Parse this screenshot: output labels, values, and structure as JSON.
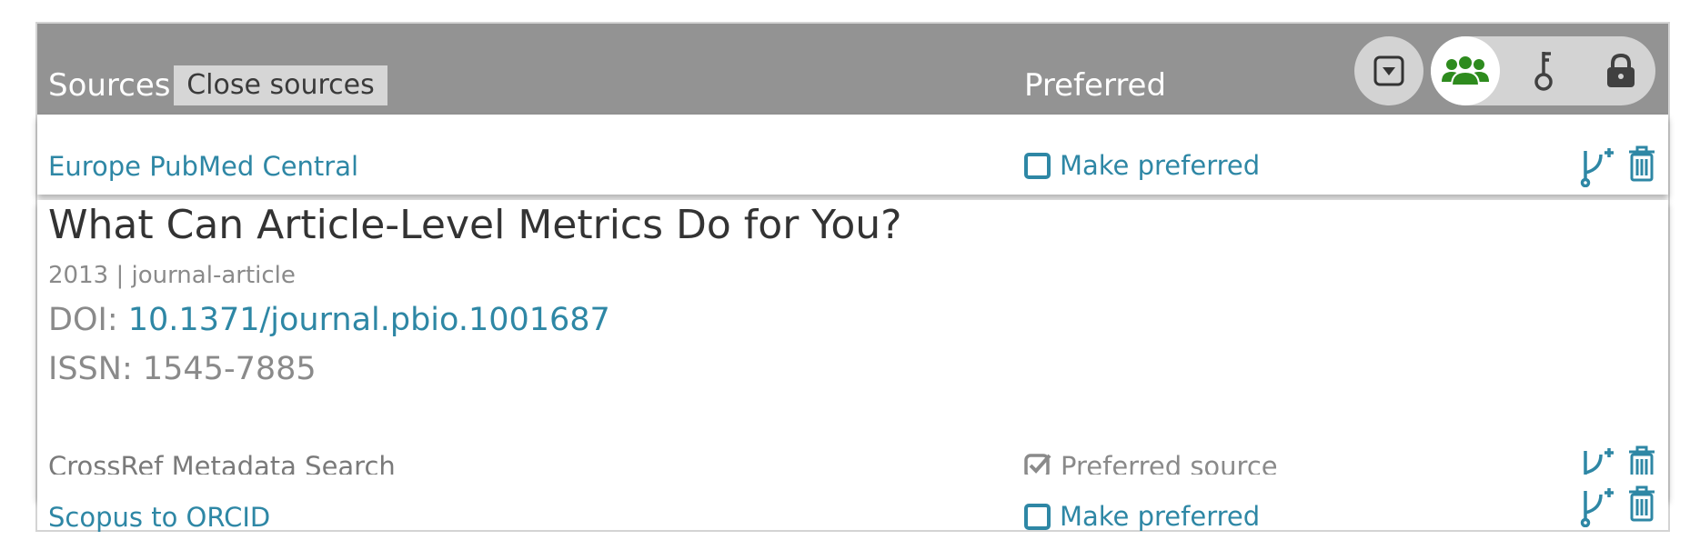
{
  "header": {
    "sources_label": "Sources",
    "close_sources_label": "Close sources",
    "preferred_label": "Preferred",
    "menu_icon": "dropdown-square-icon",
    "visibility_options": [
      "everyone-icon",
      "trusted-key-icon",
      "private-lock-icon"
    ],
    "active_visibility": "everyone"
  },
  "sources": [
    {
      "name": "Europe PubMed Central",
      "preferred_action": "Make preferred"
    },
    {
      "name": "CrossRef Metadata Search",
      "preferred_status": "Preferred source"
    },
    {
      "name": "Scopus to ORCID",
      "preferred_action": "Make preferred"
    }
  ],
  "work": {
    "title": "What Can Article-Level Metrics Do for You?",
    "year": "2013",
    "separator": "|",
    "type": "journal-article",
    "doi_label": "DOI:",
    "doi": "10.1371/journal.pbio.1001687",
    "issn_label": "ISSN:",
    "issn": "1545-7885"
  },
  "colors": {
    "header_bg": "#939393",
    "link": "#2e87a5",
    "active_visibility": "#2e8b1e"
  }
}
